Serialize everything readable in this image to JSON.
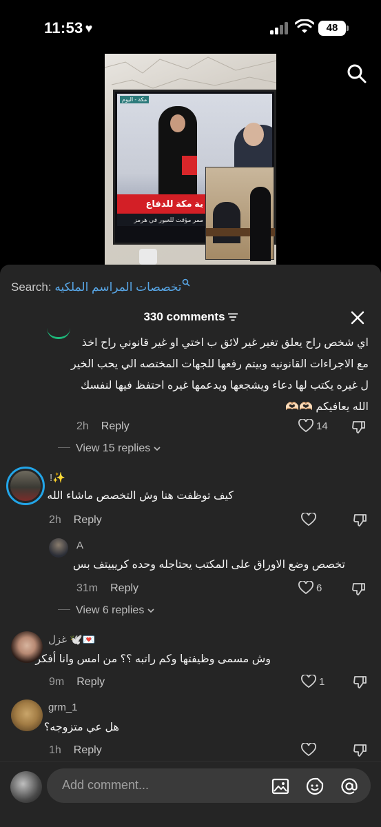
{
  "status_bar": {
    "time": "11:53",
    "battery": "48"
  },
  "search": {
    "prefix": "Search:",
    "query": "تخصصات المراسم الملكيه"
  },
  "header": {
    "comments_count": "330 comments"
  },
  "video": {
    "channel": "مكة - اليوم",
    "banner": "ية مكة للدفاع المشترك\"",
    "ticker": "ممر مؤقت للعبور في هرمز"
  },
  "comments": [
    {
      "id": "c1",
      "text_lines": [
        "اي شخص راح يعلق تغير غير لائق ب اختي او غير قانوني راح اخذ",
        "مع الاجراءات القانونيه وبيتم رفعها للجهات المختصه الي يحب الخير",
        "ل غيره يكتب لها دعاء ويشجعها ويدعمها غيره احتفظ فيها لنفسك",
        "الله يعافيكم 🫶🏻🫶🏻"
      ],
      "time": "2h",
      "reply_label": "Reply",
      "likes": "14",
      "view_replies": "View 15 replies"
    },
    {
      "id": "c2",
      "username": "!✨",
      "text": "كيف توظفت هنا وش التخصص ماشاء الله",
      "time": "2h",
      "reply_label": "Reply",
      "likes": ""
    },
    {
      "id": "c2r1",
      "username": "A",
      "text": "تخصص وضع الاوراق على المكتب يحتاجله وحده كريييتف بس",
      "time": "31m",
      "reply_label": "Reply",
      "likes": "6",
      "view_replies": "View 6 replies"
    },
    {
      "id": "c3",
      "username": "غزل 🕊️💌",
      "text": "وش مسمى وظيفتها وكم راتبه ؟؟ من امس وانا أفكر",
      "time": "9m",
      "reply_label": "Reply",
      "likes": "1"
    },
    {
      "id": "c4",
      "username": "grm_1",
      "text": "هل عي متزوجه؟",
      "time": "1h",
      "reply_label": "Reply",
      "likes": ""
    }
  ],
  "composer": {
    "placeholder": "Add comment..."
  },
  "icons": [
    "heart-icon",
    "signal-icon",
    "wifi-icon",
    "battery-icon",
    "search-icon",
    "filter-icon",
    "close-icon",
    "like-icon",
    "dislike-icon",
    "chevron-down-icon",
    "image-icon",
    "emoji-icon",
    "mention-icon"
  ],
  "colors": {
    "sheet_bg": "#252525",
    "link_blue": "#58a6e6",
    "input_bg": "#3a3a3a"
  }
}
